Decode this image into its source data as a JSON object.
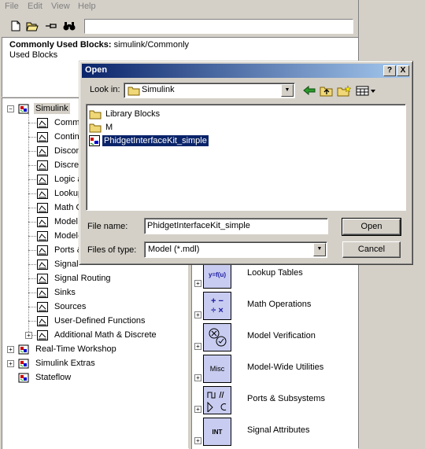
{
  "browser": {
    "menu": [
      "File",
      "Edit",
      "View",
      "Help"
    ],
    "search": {
      "value": ""
    },
    "description": {
      "title_bold": "Commonly Used Blocks:",
      "title_path": "simulink/Commonly",
      "line2": "Used Blocks"
    },
    "tree": {
      "root": "Simulink",
      "children": [
        "Commo",
        "Contin",
        "Discon",
        "Discret",
        "Logic a",
        "Lookup",
        "Math O",
        "Model",
        "Model-",
        "Ports &",
        "Signal",
        "Signal Routing",
        "Sinks",
        "Sources",
        "User-Defined Functions",
        "Additional Math & Discrete"
      ],
      "siblings": [
        "Real-Time Workshop",
        "Simulink Extras",
        "Stateflow"
      ]
    },
    "blocks": [
      {
        "label": "Lookup Tables",
        "icon": "y=f(u)"
      },
      {
        "label": "Math Operations",
        "icon": "+ − ÷ ×"
      },
      {
        "label": "Model Verification",
        "icon": "check"
      },
      {
        "label": "Model-Wide Utilities",
        "icon": "Misc"
      },
      {
        "label": "Ports & Subsystems",
        "icon": "ports"
      },
      {
        "label": "Signal Attributes",
        "icon": "INT"
      }
    ]
  },
  "dialog": {
    "title": "Open",
    "help_btn": "?",
    "close_btn": "X",
    "look_in_label": "Look in:",
    "look_in_value": "Simulink",
    "files": [
      {
        "name": "Library Blocks",
        "type": "folder",
        "selected": false
      },
      {
        "name": "M",
        "type": "folder",
        "selected": false
      },
      {
        "name": "PhidgetInterfaceKit_simple",
        "type": "model",
        "selected": true
      }
    ],
    "file_name_label": "File name:",
    "file_name_value": "PhidgetInterfaceKit_simple",
    "file_type_label": "Files of type:",
    "file_type_value": "Model (*.mdl)",
    "open_btn": "Open",
    "cancel_btn": "Cancel"
  }
}
